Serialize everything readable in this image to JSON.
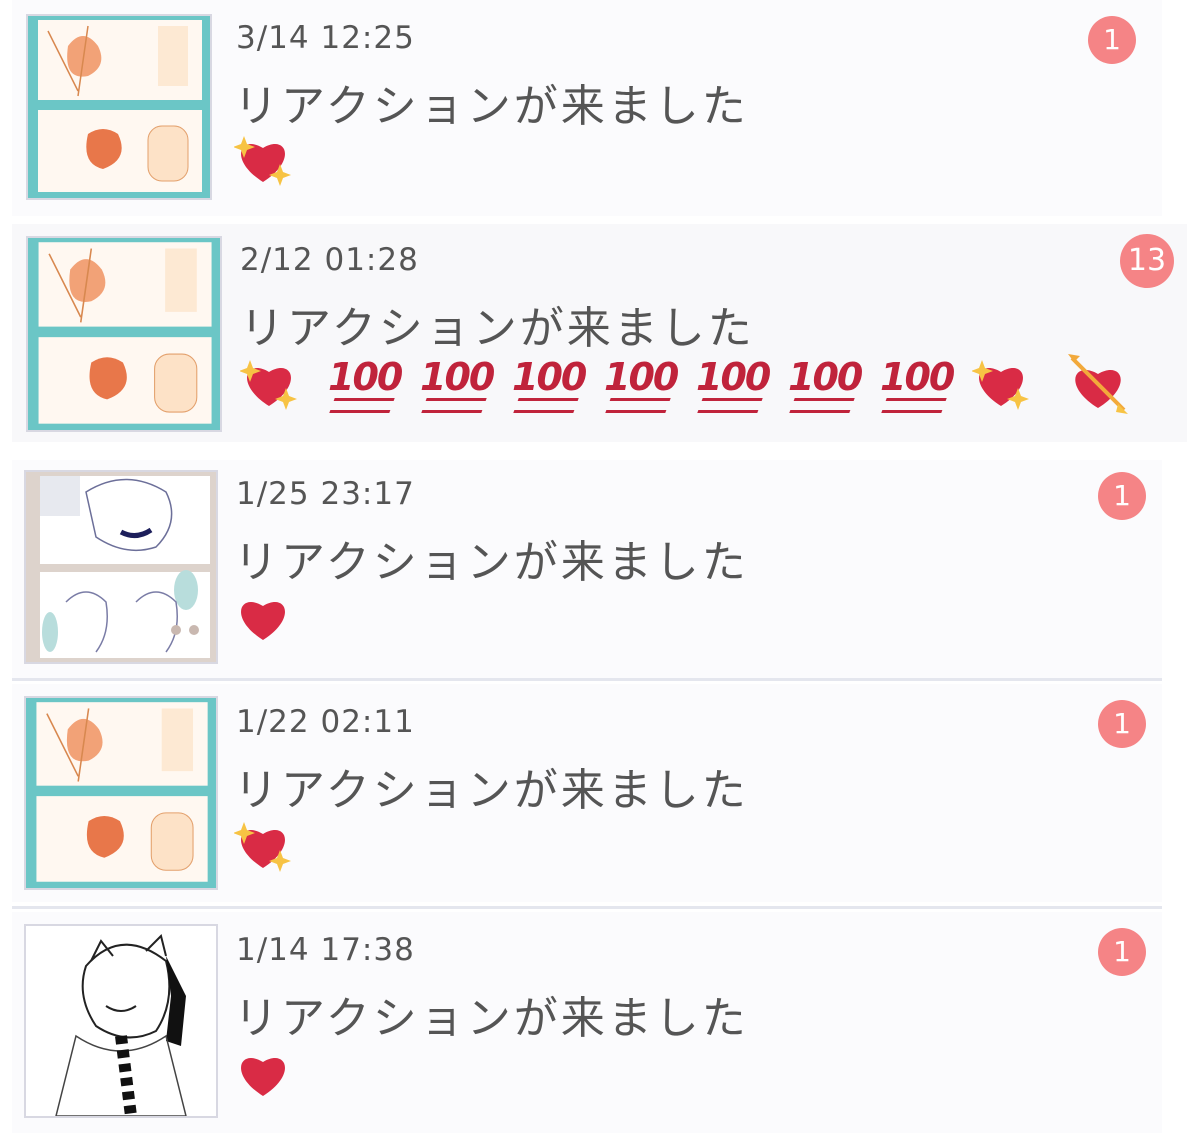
{
  "notifications": [
    {
      "date": "3/14 12:25",
      "title": "リアクションが来ました",
      "count": "1",
      "thumb": "manga-tanuki",
      "reactions": [
        "sparkling-heart-icon"
      ]
    },
    {
      "date": "2/12 01:28",
      "title": "リアクションが来ました",
      "count": "13",
      "thumb": "manga-tanuki",
      "reactions": [
        "sparkling-heart-icon",
        "hundred-points-icon",
        "hundred-points-icon",
        "hundred-points-icon",
        "hundred-points-icon",
        "hundred-points-icon",
        "hundred-points-icon",
        "hundred-points-icon",
        "sparkling-heart-icon",
        "heart-with-arrow-icon"
      ]
    },
    {
      "date": "1/25 23:17",
      "title": "リアクションが来ました",
      "count": "1",
      "thumb": "manga-lineart",
      "reactions": [
        "red-heart-icon"
      ]
    },
    {
      "date": "1/22 02:11",
      "title": "リアクションが来ました",
      "count": "1",
      "thumb": "manga-tanuki",
      "reactions": [
        "sparkling-heart-icon"
      ]
    },
    {
      "date": "1/14 17:38",
      "title": "リアクションが来ました",
      "count": "1",
      "thumb": "character-sketch",
      "reactions": [
        "red-heart-icon"
      ]
    }
  ],
  "hundred_text": "100",
  "colors": {
    "badge": "#f58486",
    "heart": "#d92b45",
    "sparkle": "#f7c344",
    "hundred": "#c0233b"
  }
}
